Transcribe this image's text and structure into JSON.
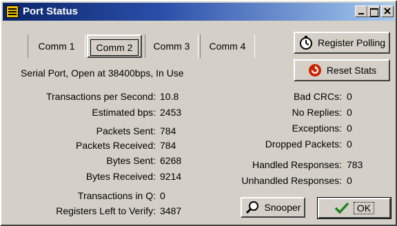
{
  "window": {
    "title": "Port Status"
  },
  "tabs": [
    "Comm 1",
    "Comm 2",
    "Comm 3",
    "Comm 4"
  ],
  "buttons": {
    "register_polling": "Register Polling",
    "reset_stats": "Reset Stats",
    "snooper": "Snooper",
    "ok": "OK"
  },
  "status": "Serial Port, Open at 38400bps, In Use",
  "stats_left": [
    {
      "label": "Transactions per Second:",
      "value": "10.8"
    },
    {
      "label": "Estimated bps:",
      "value": "2453"
    },
    {
      "label": "Packets Sent:",
      "value": "784"
    },
    {
      "label": "Packets Received:",
      "value": "784"
    },
    {
      "label": "Bytes Sent:",
      "value": "6268"
    },
    {
      "label": "Bytes Received:",
      "value": "9214"
    },
    {
      "label": "Transactions in Q:",
      "value": "0"
    },
    {
      "label": "Registers Left to Verify:",
      "value": "3487"
    }
  ],
  "stats_right": [
    {
      "label": "Bad CRCs:",
      "value": "0"
    },
    {
      "label": "No Replies:",
      "value": "0"
    },
    {
      "label": "Exceptions:",
      "value": "0"
    },
    {
      "label": "Dropped Packets:",
      "value": "0"
    },
    {
      "label": "Handled Responses:",
      "value": "783"
    },
    {
      "label": "Unhandled Responses:",
      "value": "0"
    }
  ],
  "colors": {
    "face": "#d4d0c8",
    "title_start": "#0a246a",
    "title_end": "#a6caf0",
    "reset_icon": "#cc2200",
    "ok_check": "#208020"
  },
  "icons": {
    "app": "app-icon",
    "register_polling": "stopwatch-icon",
    "reset_stats": "reset-arrow-icon",
    "snooper": "magnifier-icon",
    "ok": "checkmark-icon"
  }
}
